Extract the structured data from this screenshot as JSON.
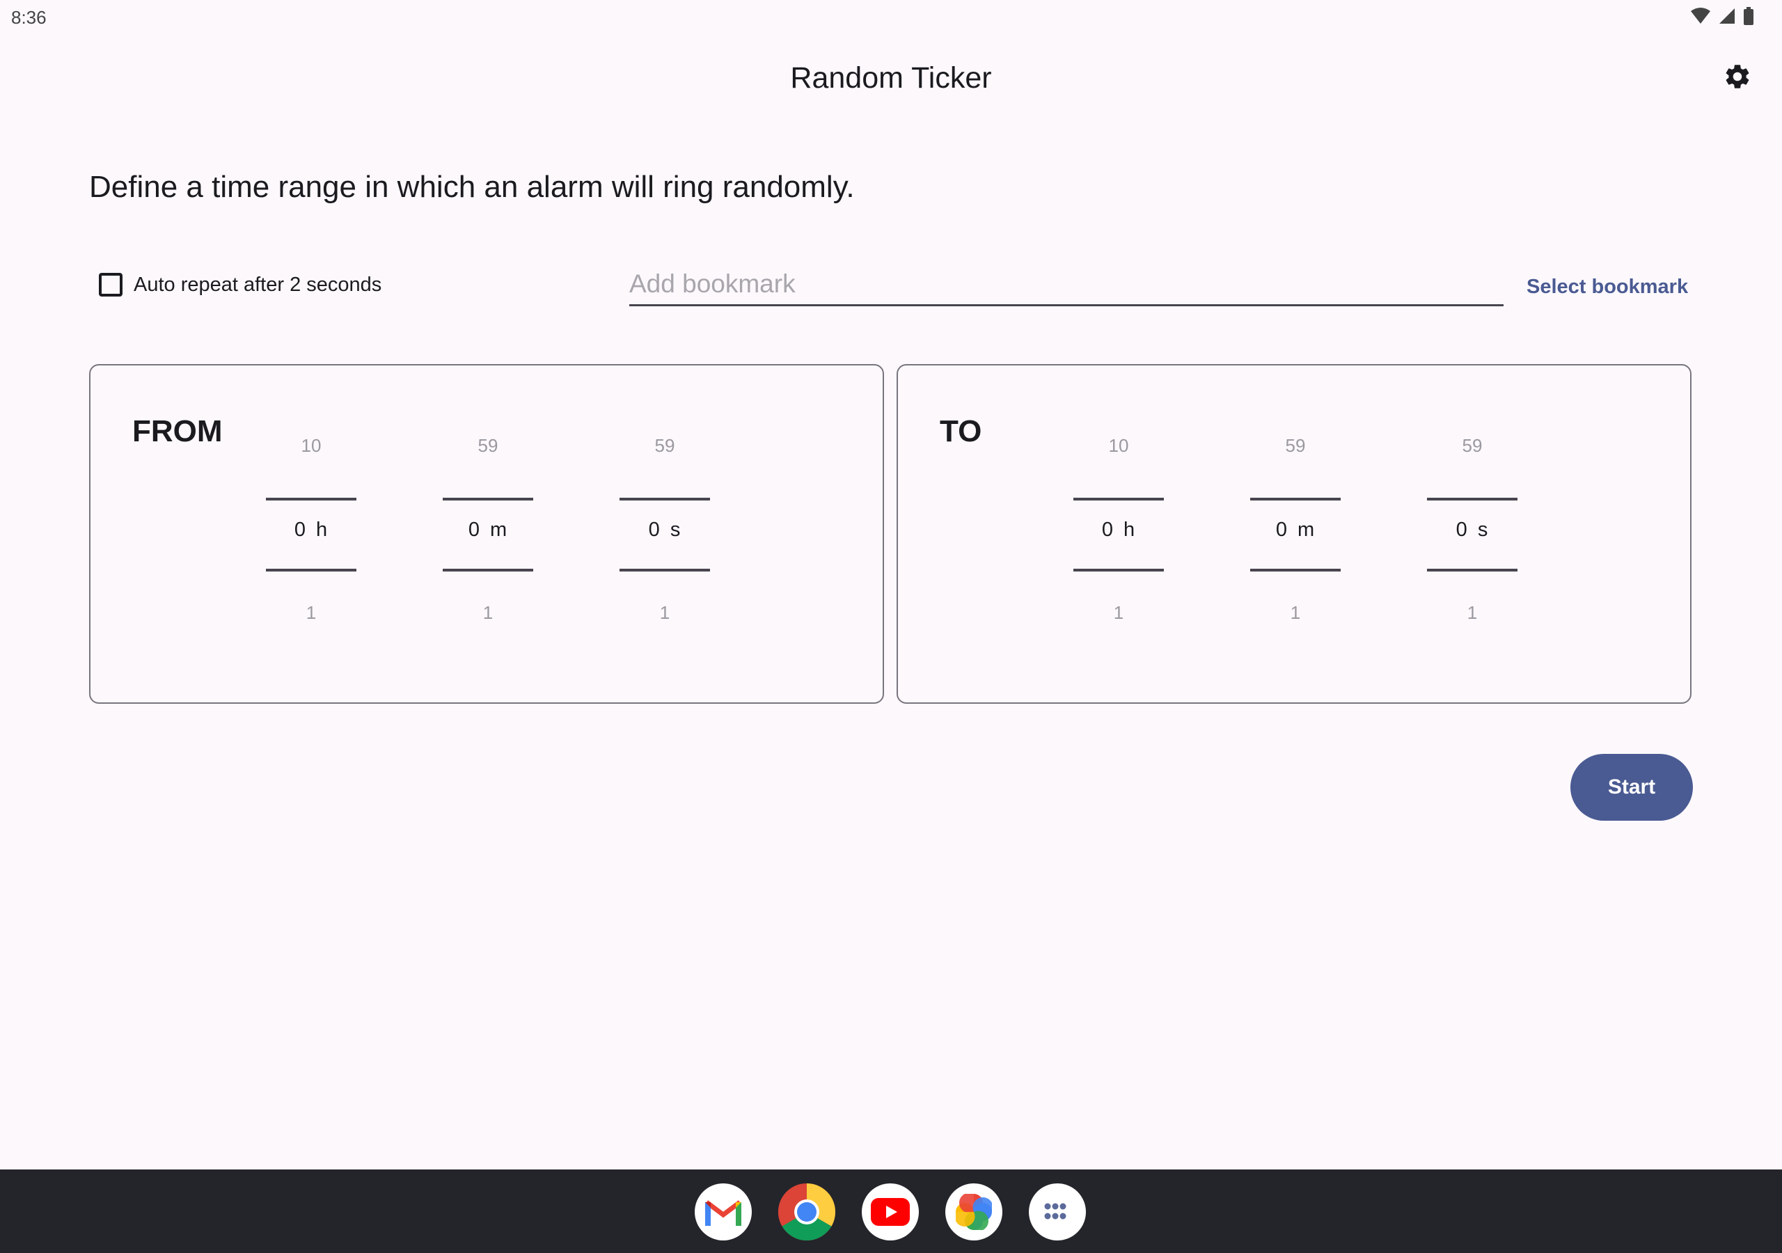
{
  "status_bar": {
    "time": "8:36",
    "icons": [
      "wifi-icon",
      "signal-icon",
      "battery-icon"
    ]
  },
  "app": {
    "title": "Random Ticker",
    "settings_icon": "gear-icon"
  },
  "description": "Define a time range in which an alarm will ring randomly.",
  "auto_repeat": {
    "label": "Auto repeat after 2 seconds",
    "checked": false
  },
  "bookmark": {
    "placeholder": "Add bookmark",
    "value": "",
    "select_label": "Select bookmark"
  },
  "from": {
    "label": "FROM",
    "hours": {
      "prev": "10",
      "value": "0",
      "unit": "h",
      "next": "1"
    },
    "minutes": {
      "prev": "59",
      "value": "0",
      "unit": "m",
      "next": "1"
    },
    "seconds": {
      "prev": "59",
      "value": "0",
      "unit": "s",
      "next": "1"
    }
  },
  "to": {
    "label": "TO",
    "hours": {
      "prev": "10",
      "value": "0",
      "unit": "h",
      "next": "1"
    },
    "minutes": {
      "prev": "59",
      "value": "0",
      "unit": "m",
      "next": "1"
    },
    "seconds": {
      "prev": "59",
      "value": "0",
      "unit": "s",
      "next": "1"
    }
  },
  "start_button": "Start",
  "colors": {
    "accent": "#4a5a92",
    "background": "#fcf8fc",
    "nav_bar": "#24252a"
  },
  "dock": [
    "gmail-icon",
    "chrome-icon",
    "youtube-icon",
    "photos-icon",
    "app-drawer-icon"
  ]
}
